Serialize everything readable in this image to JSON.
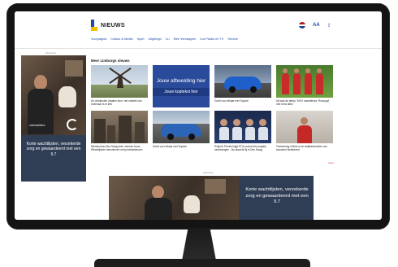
{
  "header": {
    "logo_text": "NIEUWS",
    "font_size_label": "AA",
    "nav": [
      "Voorpagina",
      "Cultuur & Media",
      "Sport",
      "Uitgelegd",
      "1Ll",
      "Mee Verstappen",
      "Live Radio en TV",
      "Service"
    ]
  },
  "ads": {
    "label": "advertentie",
    "left_brand": "cortonaclinics",
    "left_text": "Korte wachtlijsten, verzekerde zorg en gewaardeerd met een 9.7",
    "bottom_text": "Korte wachtlijsten, verzekerde zorg en gewaardeerd met een 9.7"
  },
  "section": {
    "title": "Meer Limburgs nieuws",
    "more_link": "meer ›",
    "cards": [
      {
        "title": "De windmolen draaien door: het ontdekt van molenaar is in trek"
      },
      {
        "placeholder_title": "Jouw afbeelding hier",
        "placeholder_sub": "Jouw koptekst hier"
      },
      {
        "title": "Goed voor elkaar met Toyota!"
      },
      {
        "title": "Uit was de derby: 'MVV machteloze, Roda gaf niet eens alles'"
      },
      {
        "title": "Stembureau Den Haag sluit, mensen boos - Stemblijcken beschreven met protesteleuzen"
      },
      {
        "title": "Goed voor elkaar met Toyota!"
      },
      {
        "title": "Exitpoll: Peetra krijgt 87,8 procent bij zorgslip verkiezingen - Nu staat dit tij in Den Haag."
      },
      {
        "title": "Toekenning Online is de kwijtbewerviker van bouwend Nederland"
      }
    ]
  },
  "colors": {
    "brand_blue": "#1e4aa8",
    "logo_yellow": "#f2c200",
    "ad_navy": "#2f3d55"
  }
}
